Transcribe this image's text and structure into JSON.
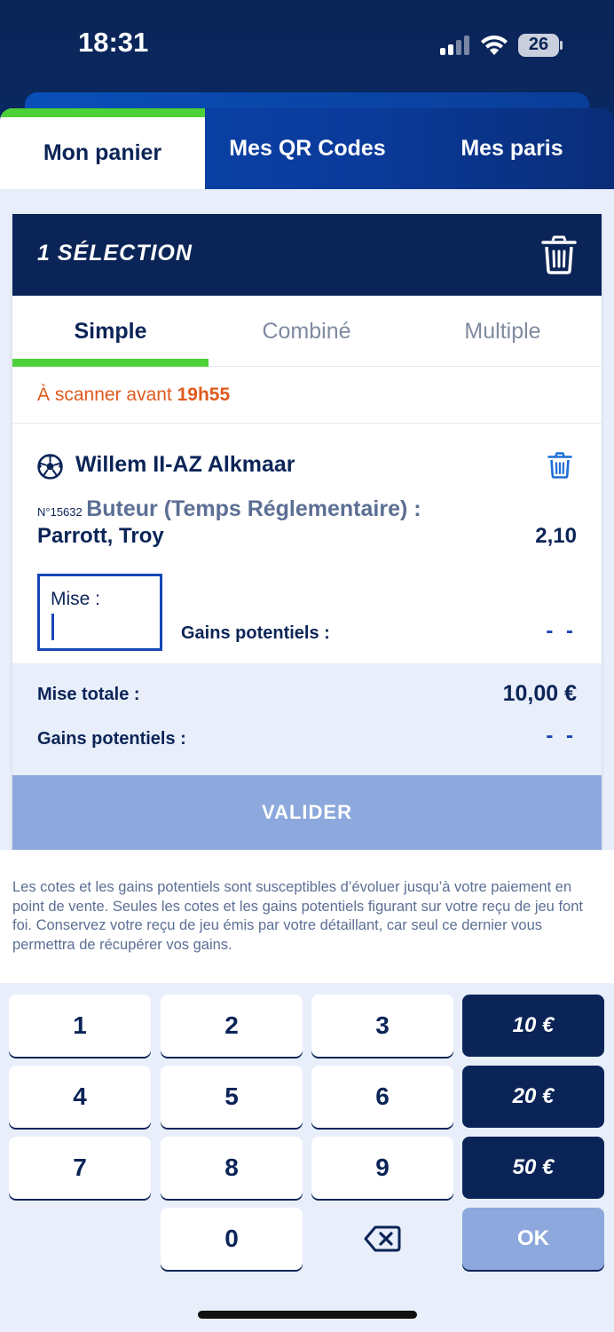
{
  "status_bar": {
    "time": "18:31",
    "battery": "26"
  },
  "top_tabs": [
    {
      "label": "Mon panier",
      "active": true
    },
    {
      "label": "Mes QR Codes",
      "active": false
    },
    {
      "label": "Mes paris",
      "active": false
    }
  ],
  "card": {
    "title": "1 SÉLECTION",
    "bet_types": [
      {
        "label": "Simple",
        "active": true
      },
      {
        "label": "Combiné",
        "active": false
      },
      {
        "label": "Multiple",
        "active": false
      }
    ],
    "scan_prefix": "À scanner avant ",
    "scan_time": "19h55",
    "match": "Willem II-AZ Alkmaar",
    "bet_number": "N°15632",
    "market": "Buteur (Temps Réglementaire) :",
    "selection": "Parrott, Troy",
    "odds": "2,10",
    "stake_label": "Mise :",
    "stake_value": "",
    "potential_gains_label": "Gains potentiels :",
    "potential_gains_value": "- -",
    "total_stake_label": "Mise totale :",
    "total_stake_value": "10,00 €",
    "total_gains_label": "Gains potentiels :",
    "total_gains_value": "- -",
    "validate_label": "VALIDER"
  },
  "disclaimer": "Les cotes et les gains potentiels sont susceptibles d’évoluer jusqu’à votre paiement en point de vente. Seules les cotes et les gains potentiels figurant sur votre reçu de jeu font foi. Conservez votre reçu de jeu émis par votre détaillant, car seul ce dernier vous permettra de récupérer vos gains.",
  "keypad": {
    "digits": [
      "1",
      "2",
      "3",
      "4",
      "5",
      "6",
      "7",
      "8",
      "9",
      "0"
    ],
    "amounts": [
      "10 €",
      "20 €",
      "50 €"
    ],
    "ok_label": "OK",
    "delete_icon": "backspace-icon"
  },
  "colors": {
    "navy": "#0b2457",
    "accent_green": "#4cd137",
    "link_blue": "#1846b8",
    "warning_orange": "#e05a1e",
    "disabled_blue": "#8ca8dc",
    "light_bg": "#e8eefa"
  }
}
